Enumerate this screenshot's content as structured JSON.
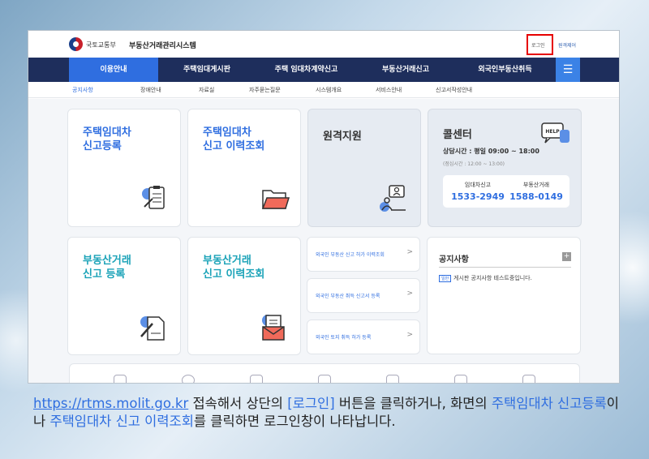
{
  "header": {
    "ministry": "국토교통부",
    "system_title": "부동산거래관리시스템",
    "login": "로그인",
    "remote_support": "원격제어"
  },
  "nav": {
    "items": [
      "이용안내",
      "주택임대게시판",
      "주택 임대차계약신고",
      "부동산거래신고",
      "외국인부동산취득"
    ],
    "menu_icon": "hamburger-icon"
  },
  "subnav": {
    "items": [
      "공지사항",
      "장애안내",
      "자료실",
      "자주묻는질문",
      "시스템개요",
      "서비스안내",
      "신고서작성안내"
    ]
  },
  "cards": {
    "housing_lease_report": "주택임대차\n신고등록",
    "housing_lease_history": "주택임대차\n신고 이력조회",
    "remote": "원격지원",
    "real_estate_report": "부동산거래\n신고 등록",
    "real_estate_history": "부동산거래\n신고 이력조회"
  },
  "call_center": {
    "title": "콜센터",
    "hours": "상담시간 : 평일 09:00 ~ 18:00",
    "lunch": "(점심시간 : 12:00 ~ 13:00)",
    "lease_label": "임대차신고",
    "lease_number": "1533-2949",
    "trade_label": "부동산거래",
    "trade_number": "1588-0149"
  },
  "links": [
    "외국인 부동산 신고 허가 이력조회",
    "외국인 부동산 취득 신고서 등록",
    "외국인 토지 취득 허가 등록"
  ],
  "notice": {
    "title": "공지사항",
    "badge": "일반",
    "item": "게시판 공지사항 테스트중입니다."
  },
  "caption": {
    "url": "https://rtms.molit.go.kr",
    "t1": " 접속해서 상단의 ",
    "login": "[로그인]",
    "t2": " 버튼을 클릭하거나, 화면의 ",
    "hl1": "주택임대차 신고등록",
    "t3": "이나 ",
    "hl2": "주택임대차 신고 이력조회",
    "t4": "를 클릭하면 로그인창이 나타납니다."
  },
  "colors": {
    "nav_bg": "#1e2e5c",
    "accent": "#2f6ee0",
    "teal": "#1ba3b8",
    "highlight_box": "#e60000"
  }
}
